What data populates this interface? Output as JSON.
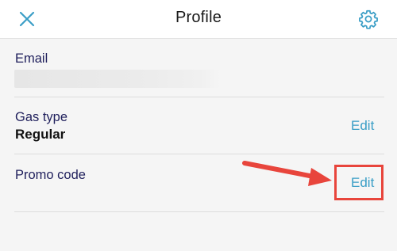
{
  "header": {
    "title": "Profile",
    "close_icon": "close-icon",
    "settings_icon": "gear-icon"
  },
  "rows": {
    "email": {
      "label": "Email",
      "value_visible": false
    },
    "gas_type": {
      "label": "Gas type",
      "value": "Regular",
      "edit_label": "Edit"
    },
    "promo_code": {
      "label": "Promo code",
      "edit_label": "Edit"
    }
  },
  "annotation": {
    "color": "#e8453c"
  },
  "colors": {
    "accent": "#3a9ec6",
    "label": "#1f1f5c",
    "background": "#f5f5f5"
  }
}
